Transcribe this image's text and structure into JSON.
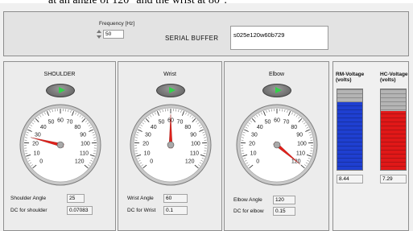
{
  "caption": "at an angle of 120° and the wrist at 80°.",
  "top": {
    "frequency_label": "Frequency [Hz]",
    "frequency_value": "50",
    "serial_buffer_label": "SERIAL BUFFER",
    "serial_buffer_value": "s025e120w60b729"
  },
  "gauges": [
    {
      "id": "shoulder",
      "title": "SHOULDER",
      "needle_value": 25,
      "needle_color": "#e0201a",
      "angle_label": "Shoulder Angle",
      "angle_value": "25",
      "dc_label": "DC for shoulder",
      "dc_value": "0.07083"
    },
    {
      "id": "wrist",
      "title": "Wrist",
      "needle_value": 60,
      "needle_color": "#e0201a",
      "angle_label": "Wrist Angle",
      "angle_value": "60",
      "dc_label": "DC for Wrist",
      "dc_value": "0.1"
    },
    {
      "id": "elbow",
      "title": "Elbow",
      "needle_value": 120,
      "needle_color": "#e0201a",
      "angle_label": "Elbow Angle",
      "angle_value": "120",
      "dc_label": "DC for elbow",
      "dc_value": "0.15"
    }
  ],
  "gauge_scale": {
    "min": 0,
    "max": 120,
    "major_ticks": [
      0,
      10,
      20,
      30,
      40,
      50,
      60,
      70,
      80,
      90,
      100,
      110,
      120
    ]
  },
  "voltages": [
    {
      "label_line1": "RM-Voltage",
      "label_line2": "(volts)",
      "value": "8.44",
      "level_fraction": 0.84,
      "fill_color": "#1f3fd0"
    },
    {
      "label_line1": "HC-Voltage",
      "label_line2": "(volts)",
      "value": "7.29",
      "level_fraction": 0.73,
      "fill_color": "#e01818"
    }
  ]
}
